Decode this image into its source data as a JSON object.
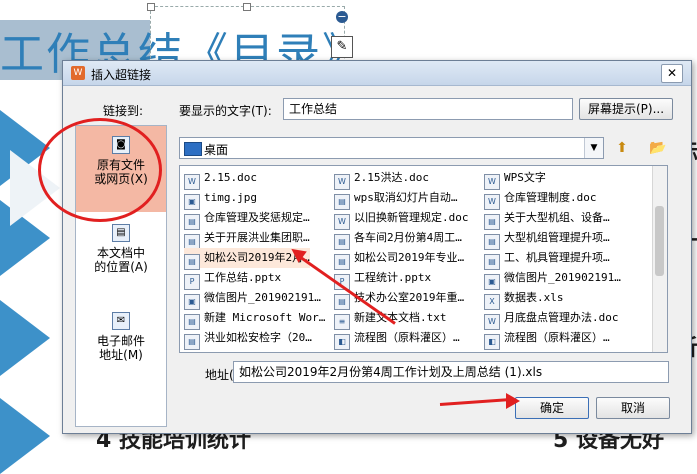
{
  "slide": {
    "title": "工作总结《目录》",
    "bottom_left": "4 技能培训统计",
    "bottom_right": "5 设备无好",
    "side_texts": [
      "标",
      "计",
      "析",
      "针"
    ]
  },
  "dialog": {
    "title": "插入超链接",
    "link_to_label": "链接到:",
    "display_text_label": "要显示的文字(T):",
    "display_text_value": "工作总结",
    "screen_tip_button": "屏幕提示(P)...",
    "nav": [
      {
        "label": "原有文件\n或网页(X)"
      },
      {
        "label": "本文档中\n的位置(A)"
      },
      {
        "label": "电子邮件\n地址(M)"
      }
    ],
    "location": "桌面",
    "files": [
      [
        "2.15.doc",
        "2.15洪达.doc",
        "WPS文字"
      ],
      [
        "timg.jpg",
        "wps取消幻灯片自动…",
        "仓库管理制度.doc"
      ],
      [
        "仓库管理及奖惩规定…",
        "以旧换新管理规定.doc",
        "关于大型机组、设备…"
      ],
      [
        "关于开展洪业集团职…",
        "各车间2月份第4周工…",
        "大型机组管理提升项…"
      ],
      [
        "如松公司2019年2月…",
        "如松公司2019年专业…",
        "工、机具管理提升项…"
      ],
      [
        "工作总结.pptx",
        "工程统计.pptx",
        "微信图片_201902191…"
      ],
      [
        "微信图片_201902191…",
        "技术办公室2019年重…",
        "数据表.xls"
      ],
      [
        "新建 Microsoft Wor…",
        "新建文本文档.txt",
        "月底盘点管理办法.doc"
      ],
      [
        "洪业如松安检字（20…",
        "流程图（原料灌区）…",
        "流程图（原料灌区）…"
      ]
    ],
    "address_label": "地址(E):",
    "address_value": "如松公司2019年2月份第4周工作计划及上周总结 (1).xls",
    "ok_button": "确定",
    "cancel_button": "取消"
  }
}
